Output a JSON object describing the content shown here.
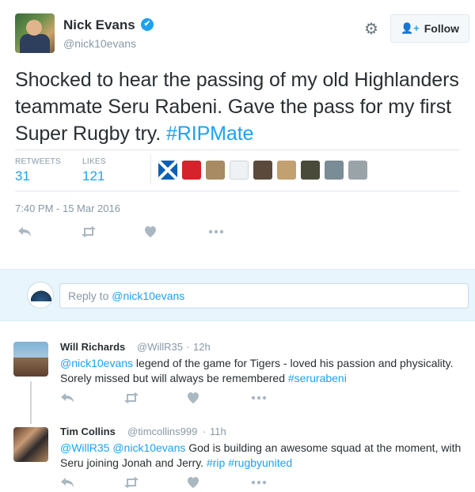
{
  "tweet": {
    "author_name": "Nick Evans",
    "author_handle": "@nick10evans",
    "verified_glyph": "✔",
    "follow_label": "Follow",
    "text_part1": "Shocked to hear the passing of my old Highlanders teammate Seru Rabeni. Gave the pass for my first Super Rugby try. ",
    "hashtag": "#RIPMate",
    "stats": {
      "retweets_label": "RETWEETS",
      "retweets_value": "31",
      "likes_label": "LIKES",
      "likes_value": "121"
    },
    "timestamp": "7:40 PM - 15 Mar 2016",
    "icons": {
      "reply": "reply-icon",
      "retweet": "retweet-icon",
      "like": "heart-icon",
      "more": "more-icon"
    }
  },
  "reply_box": {
    "prefix": "Reply to ",
    "handle": "@nick10evans"
  },
  "replies": [
    {
      "name": "Will Richards",
      "handle": "@WillR35",
      "sep": "·",
      "time": "12h",
      "mention": "@nick10evans",
      "text": " legend of the game for Tigers - loved his passion and physicality. Sorely missed but will always be remembered ",
      "hashtag": "#serurabeni"
    },
    {
      "name": "Tim Collins",
      "handle": "@timcollins999",
      "sep": "·",
      "time": "11h",
      "mention1": "@WillR35",
      "mention2": "@nick10evans",
      "text": " God is building an awesome squad at the moment, with Seru joining Jonah and Jerry. ",
      "hashtag1": "#rip",
      "hashtag2": "#rugbyunited"
    }
  ],
  "colors": {
    "accent": "#1da1f2",
    "muted": "#8899a6",
    "reply_bg": "#e8f5fd"
  }
}
